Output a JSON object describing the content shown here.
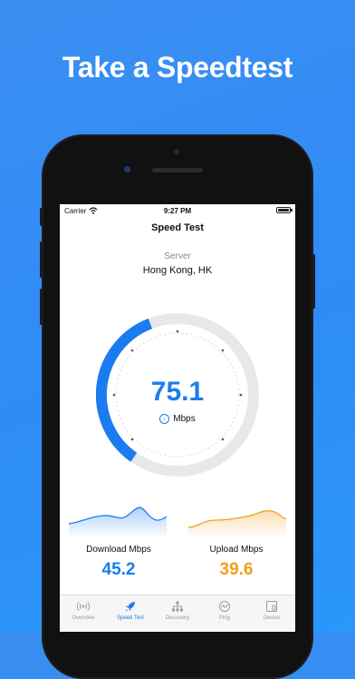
{
  "headline": "Take a Speedtest",
  "status": {
    "carrier": "Carrier",
    "time": "9:27 PM"
  },
  "nav": {
    "title": "Speed Test"
  },
  "server": {
    "label": "Server",
    "value": "Hong Kong, HK"
  },
  "gauge": {
    "value": "75.1",
    "unit": "Mbps",
    "accent": "#1a7cf0"
  },
  "download": {
    "label": "Download Mbps",
    "value": "45.2",
    "color": "#1a7cf0"
  },
  "upload": {
    "label": "Upload Mbps",
    "value": "39.6",
    "color": "#f2a01e"
  },
  "tabs": [
    {
      "label": "Overview",
      "icon": "radio-waves-icon",
      "active": false
    },
    {
      "label": "Speed Test",
      "icon": "rocket-icon",
      "active": true
    },
    {
      "label": "Discovery",
      "icon": "network-icon",
      "active": false
    },
    {
      "label": "Ping",
      "icon": "ping-icon",
      "active": false
    },
    {
      "label": "Device",
      "icon": "device-icon",
      "active": false
    }
  ]
}
